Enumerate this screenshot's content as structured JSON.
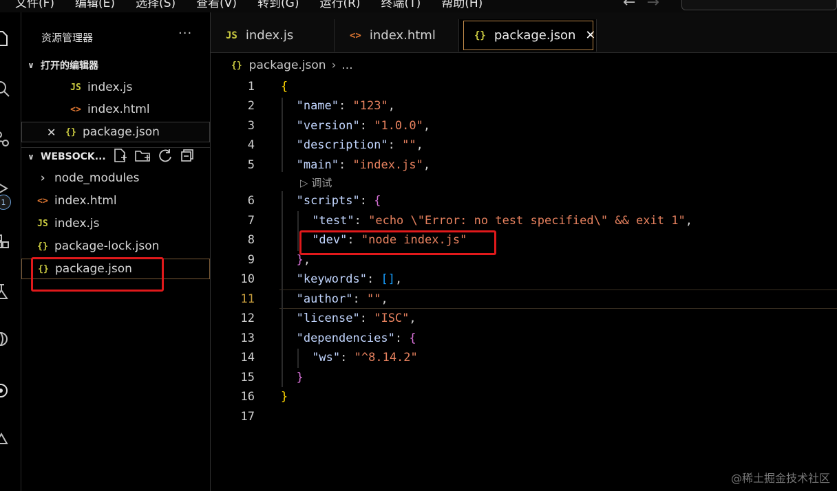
{
  "menubar": {
    "items": [
      "文件(F)",
      "编辑(E)",
      "选择(S)",
      "查看(V)",
      "转到(G)",
      "运行(R)",
      "终端(T)",
      "帮助(H)"
    ]
  },
  "activity": {
    "badge_count": "1"
  },
  "sidebar": {
    "title": "资源管理器",
    "more_label": "···",
    "open_editors": {
      "header": "打开的编辑器",
      "items": [
        {
          "icon": "JS",
          "label": "index.js"
        },
        {
          "icon": "<>",
          "label": "index.html"
        },
        {
          "icon": "{}",
          "label": "package.json",
          "close": "✕"
        }
      ]
    },
    "workspace": {
      "header": "WEBSOCK...",
      "items": [
        {
          "icon": "›",
          "label": "node_modules"
        },
        {
          "icon": "<>",
          "label": "index.html"
        },
        {
          "icon": "JS",
          "label": "index.js"
        },
        {
          "icon": "{}",
          "label": "package-lock.json"
        },
        {
          "icon": "{}",
          "label": "package.json"
        }
      ]
    }
  },
  "tabs": [
    {
      "icon": "JS",
      "label": "index.js"
    },
    {
      "icon": "<>",
      "label": "index.html"
    },
    {
      "icon": "{}",
      "label": "package.json",
      "close": "✕"
    }
  ],
  "breadcrumb": {
    "icon": "{}",
    "file": "package.json",
    "sep": "›",
    "rest": "..."
  },
  "editor": {
    "current_line": 11,
    "codelens": "调试",
    "lines": [
      {
        "n": "1",
        "text": "{"
      },
      {
        "n": "2",
        "text": "\"name\": \"123\","
      },
      {
        "n": "3",
        "text": "\"version\": \"1.0.0\","
      },
      {
        "n": "4",
        "text": "\"description\": \"\","
      },
      {
        "n": "5",
        "text": "\"main\": \"index.js\","
      },
      {
        "n": "6",
        "text": "\"scripts\": {"
      },
      {
        "n": "7",
        "text": "\"test\": \"echo \\\"Error: no test specified\\\" && exit 1\","
      },
      {
        "n": "8",
        "text": "\"dev\": \"node index.js\""
      },
      {
        "n": "9",
        "text": "},"
      },
      {
        "n": "10",
        "text": "\"keywords\": [],"
      },
      {
        "n": "11",
        "text": "\"author\": \"\","
      },
      {
        "n": "12",
        "text": "\"license\": \"ISC\","
      },
      {
        "n": "13",
        "text": "\"dependencies\": {"
      },
      {
        "n": "14",
        "text": "\"ws\": \"^8.14.2\""
      },
      {
        "n": "15",
        "text": "}"
      },
      {
        "n": "16",
        "text": "}"
      },
      {
        "n": "17",
        "text": ""
      }
    ]
  },
  "watermark": "@稀土掘金技术社区",
  "colors": {
    "highlight_box": "#e0191b",
    "string": "#e8825f",
    "key": "#c2d6ff",
    "bracket_level1": "#ffd700",
    "bracket_level2": "#d670d6"
  }
}
